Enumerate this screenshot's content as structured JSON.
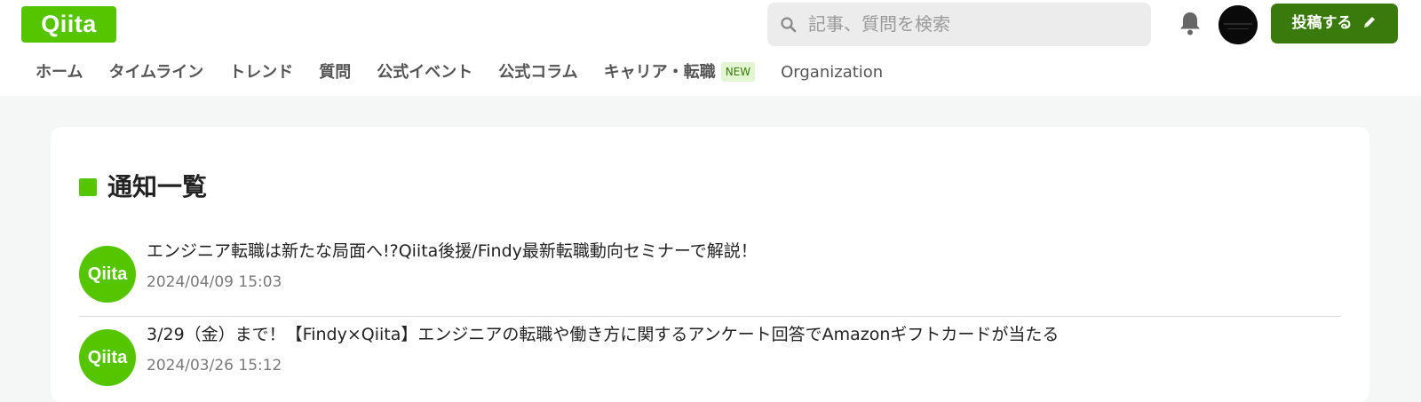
{
  "header": {
    "logo_text": "Qiita",
    "search_placeholder": "記事、質問を検索",
    "post_button_label": "投稿する",
    "icons": {
      "search": "search-icon",
      "bell": "bell-icon",
      "pen": "pencil-icon"
    }
  },
  "nav": {
    "items": [
      {
        "label": "ホーム"
      },
      {
        "label": "タイムライン"
      },
      {
        "label": "トレンド"
      },
      {
        "label": "質問"
      },
      {
        "label": "公式イベント"
      },
      {
        "label": "公式コラム"
      },
      {
        "label": "キャリア・転職",
        "badge": "NEW"
      },
      {
        "label": "Organization"
      }
    ]
  },
  "main": {
    "title": "通知一覧",
    "notifications": [
      {
        "icon_text": "Qiita",
        "text": "エンジニア転職は新たな局面へ!?Qiita後援/Findy最新転職動向セミナーで解説！",
        "date": "2024/04/09 15:03"
      },
      {
        "icon_text": "Qiita",
        "text": "3/29（金）まで！【Findy×Qiita】エンジニアの転職や働き方に関するアンケート回答でAmazonギフトカードが当たる",
        "date": "2024/03/26 15:12"
      }
    ]
  },
  "colors": {
    "brand": "#55c500",
    "button": "#3a7a0c",
    "page_bg": "#f5f6f6",
    "badge_bg": "#e3f6d2"
  }
}
